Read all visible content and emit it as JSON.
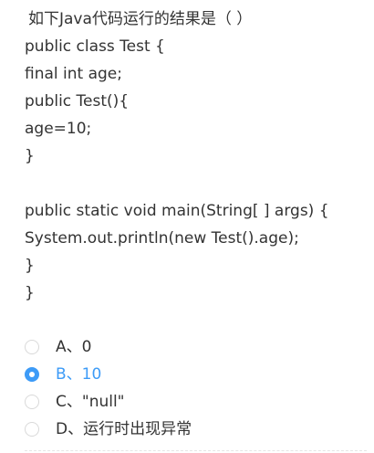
{
  "question": {
    "title": "如下Java代码运行的结果是（ ）",
    "code_lines": [
      "public class Test {",
      "final int age;",
      "public Test(){",
      "age=10;",
      "}",
      "",
      "public static void main(String[ ] args) {",
      "System.out.println(new Test().age);",
      "}",
      "}"
    ]
  },
  "options": [
    {
      "label": "A、0",
      "selected": false
    },
    {
      "label": "B、10",
      "selected": true
    },
    {
      "label": "C、\"null\"",
      "selected": false
    },
    {
      "label": "D、运行时出现异常",
      "selected": false
    }
  ],
  "colors": {
    "accent": "#3d9bf7",
    "text": "#333333",
    "radio_border": "#d9d9d9"
  }
}
